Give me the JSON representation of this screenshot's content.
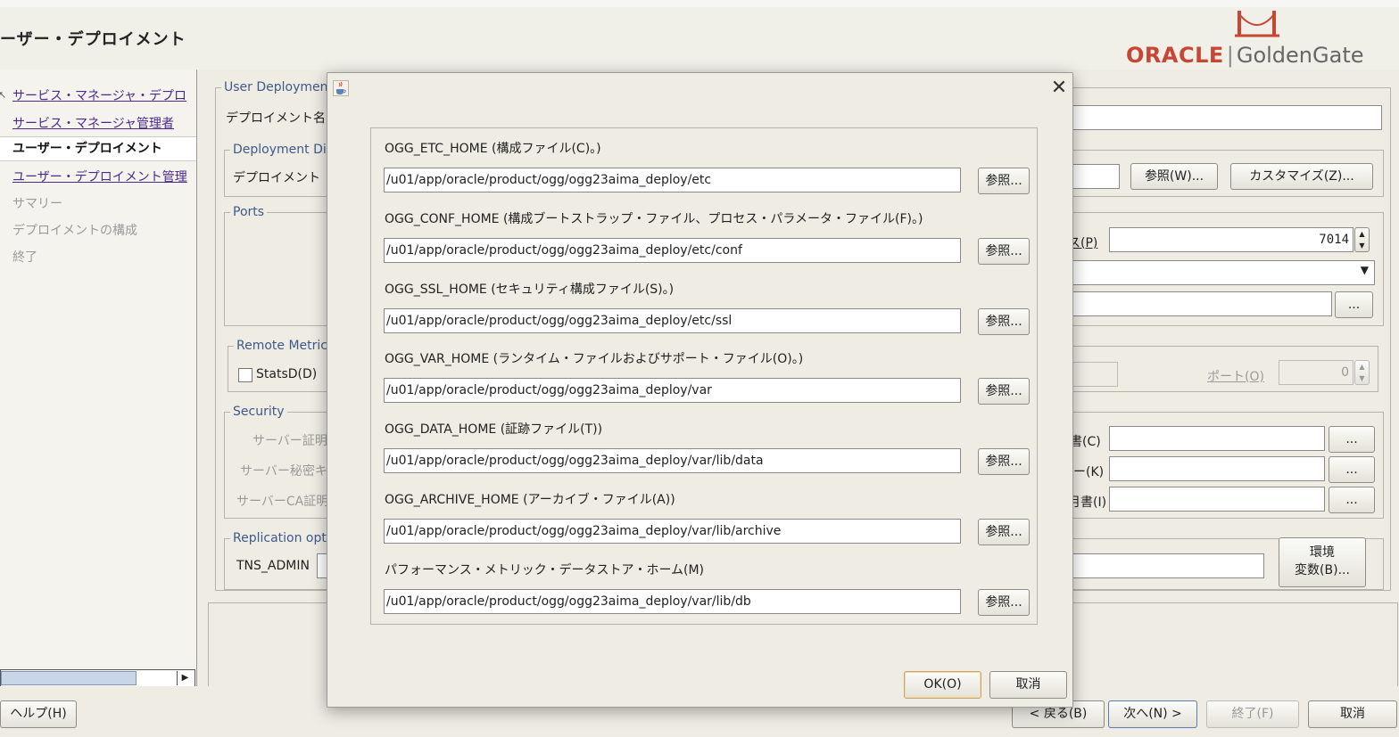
{
  "page": {
    "title": "ーザー・デプロイメント"
  },
  "logo": {
    "oracle": "ORACLE",
    "separator": "|",
    "product": "GoldenGate"
  },
  "nav": {
    "items": [
      {
        "label": "サービス・マネージャ・デプロ",
        "state": "link"
      },
      {
        "label": "サービス・マネージャ管理者",
        "state": "link"
      },
      {
        "label": "ユーザー・デプロイメント",
        "state": "current"
      },
      {
        "label": "ユーザー・デプロイメント管理",
        "state": "link"
      },
      {
        "label": "サマリー",
        "state": "disabled"
      },
      {
        "label": "デプロイメントの構成",
        "state": "disabled"
      },
      {
        "label": "終了",
        "state": "disabled"
      }
    ]
  },
  "main": {
    "user_deployment_group": "User Deploymen",
    "deployment_name_label": "デプロイメント名",
    "deployment_dir_group": "Deployment Dir",
    "deployment_dir_label": "デプロイメント",
    "browse_w_label": "参照(W)...",
    "customize_label": "カスタマイズ(Z)...",
    "ports_group": "Ports",
    "port_label_suffix": "ス(P)",
    "port_value": "7014",
    "ellipsis": "...",
    "remote_metrics_group": "Remote Metric",
    "statsd_label": "StatsD(D)",
    "statsd_port_label": "ポート(O)",
    "statsd_port_value": "0",
    "security_group": "Security",
    "server_cert_label": "サーバー証明",
    "server_key_label": "サーバー秘密キ",
    "server_ca_label": "サーバーCA証明",
    "cert_label_suffix": "書(C)",
    "key_label_suffix": "ー(K)",
    "ca_label_suffix": "月書(I)",
    "replication_group": "Replication opt",
    "tns_admin_label": "TNS_ADMIN",
    "env_button_line1": "環境",
    "env_button_line2": "変数(B)..."
  },
  "footer": {
    "help": "ヘルプ(H)",
    "back": "< 戻る(B)",
    "next": "次へ(N) >",
    "finish": "終了(F)",
    "cancel": "取消"
  },
  "dialog": {
    "close_symbol": "✕",
    "browse_label": "参照...",
    "ok_label": "OK(O)",
    "cancel_label": "取消",
    "fields": [
      {
        "label": "OGG_ETC_HOME (構成ファイル(C)。)",
        "value": "/u01/app/oracle/product/ogg/ogg23aima_deploy/etc"
      },
      {
        "label": "OGG_CONF_HOME (構成ブートストラップ・ファイル、プロセス・パラメータ・ファイル(F)。)",
        "value": "/u01/app/oracle/product/ogg/ogg23aima_deploy/etc/conf"
      },
      {
        "label": "OGG_SSL_HOME (セキュリティ構成ファイル(S)。)",
        "value": "/u01/app/oracle/product/ogg/ogg23aima_deploy/etc/ssl"
      },
      {
        "label": "OGG_VAR_HOME (ランタイム・ファイルおよびサポート・ファイル(O)。)",
        "value": "/u01/app/oracle/product/ogg/ogg23aima_deploy/var"
      },
      {
        "label": "OGG_DATA_HOME (証跡ファイル(T))",
        "value": "/u01/app/oracle/product/ogg/ogg23aima_deploy/var/lib/data"
      },
      {
        "label": "OGG_ARCHIVE_HOME (アーカイブ・ファイル(A))",
        "value": "/u01/app/oracle/product/ogg/ogg23aima_deploy/var/lib/archive"
      },
      {
        "label": "パフォーマンス・メトリック・データストア・ホーム(M)",
        "value": "/u01/app/oracle/product/ogg/ogg23aima_deploy/var/lib/db"
      }
    ]
  },
  "colors": {
    "oracle_red": "#c74634",
    "group_title_blue": "#3e5a8c",
    "link_purple": "#4b2a8c",
    "background": "#eeece3"
  }
}
